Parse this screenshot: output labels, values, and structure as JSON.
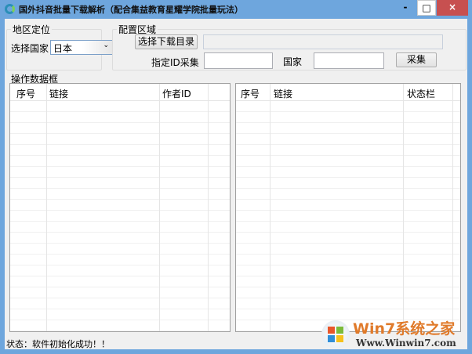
{
  "window": {
    "title": "国外抖音批量下载解析（配合集益教育星耀学院批量玩法）",
    "minimize": "-",
    "maximize": "□",
    "close": "×"
  },
  "region": {
    "group_label": "地区定位",
    "country_label": "选择国家",
    "country_value": "日本"
  },
  "config": {
    "group_label": "配置区域",
    "choose_dir_button": "选择下载目录",
    "dir_value": "",
    "id_label": "指定ID采集",
    "id_value": "",
    "country_label": "国家",
    "country_value": "",
    "collect_button": "采集"
  },
  "data_frame": {
    "label": "操作数据框",
    "left_columns": [
      "序号",
      "链接",
      "作者ID"
    ],
    "right_columns": [
      "序号",
      "链接",
      "状态栏"
    ]
  },
  "status": "状态：软件初始化成功！！",
  "watermark": {
    "brand": "Win7系统之家",
    "url": "Www.Winwin7.com"
  }
}
